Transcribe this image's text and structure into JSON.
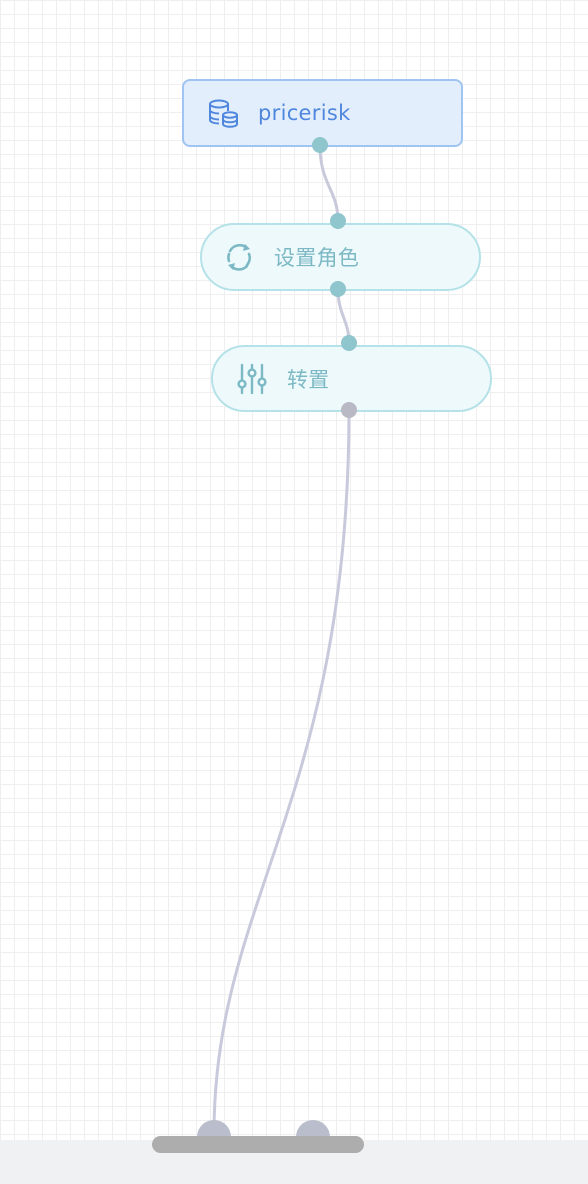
{
  "canvas": {
    "background": "#ffffff",
    "grid_color": "#efefef"
  },
  "nodes": {
    "source": {
      "label": "pricerisk",
      "icon": "database-icon",
      "accent": "#4f87de"
    },
    "set_role": {
      "label": "设置角色",
      "icon": "refresh-icon",
      "accent": "#7cb9c4"
    },
    "pivot": {
      "label": "转置",
      "icon": "sliders-icon",
      "accent": "#7cb9c4"
    }
  },
  "colors": {
    "edge": "#c9c9dc",
    "port_connected": "#8fc5cc",
    "port_idle": "#b9b9c6"
  }
}
